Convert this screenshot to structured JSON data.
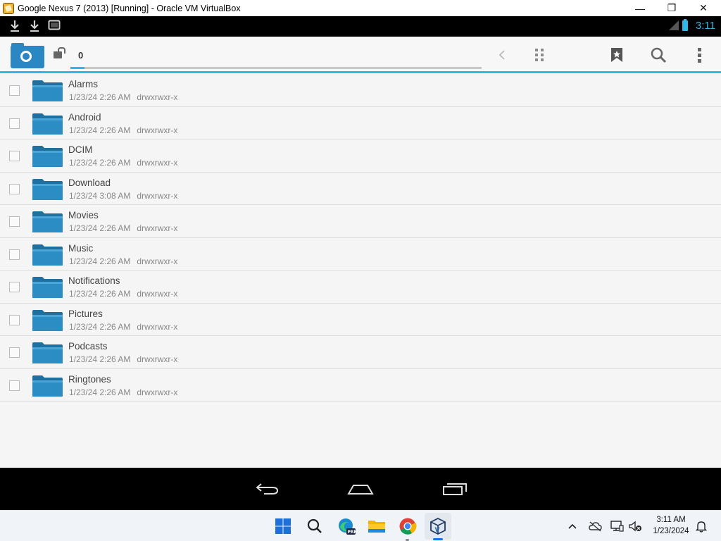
{
  "window": {
    "title": "Google Nexus 7 (2013) [Running] - Oracle VM VirtualBox",
    "minimize_glyph": "—",
    "maximize_glyph": "❐",
    "close_glyph": "✕"
  },
  "status_bar": {
    "notifications": [
      "download-icon",
      "download-icon",
      "screen-icon"
    ],
    "time": "3:11"
  },
  "action_bar": {
    "path": "0",
    "accent_color": "#33b5e5",
    "actions": [
      "back-icon",
      "grid-view-icon",
      "bookmark-icon",
      "search-icon",
      "overflow-menu-icon"
    ]
  },
  "files": [
    {
      "name": "Alarms",
      "date": "1/23/24 2:26 AM",
      "perms": "drwxrwxr-x"
    },
    {
      "name": "Android",
      "date": "1/23/24 2:26 AM",
      "perms": "drwxrwxr-x"
    },
    {
      "name": "DCIM",
      "date": "1/23/24 2:26 AM",
      "perms": "drwxrwxr-x"
    },
    {
      "name": "Download",
      "date": "1/23/24 3:08 AM",
      "perms": "drwxrwxr-x"
    },
    {
      "name": "Movies",
      "date": "1/23/24 2:26 AM",
      "perms": "drwxrwxr-x"
    },
    {
      "name": "Music",
      "date": "1/23/24 2:26 AM",
      "perms": "drwxrwxr-x"
    },
    {
      "name": "Notifications",
      "date": "1/23/24 2:26 AM",
      "perms": "drwxrwxr-x"
    },
    {
      "name": "Pictures",
      "date": "1/23/24 2:26 AM",
      "perms": "drwxrwxr-x"
    },
    {
      "name": "Podcasts",
      "date": "1/23/24 2:26 AM",
      "perms": "drwxrwxr-x"
    },
    {
      "name": "Ringtones",
      "date": "1/23/24 2:26 AM",
      "perms": "drwxrwxr-x"
    }
  ],
  "taskbar": {
    "apps": [
      "start-icon",
      "search-icon",
      "edge-icon",
      "file-explorer-icon",
      "chrome-icon",
      "virtualbox-icon"
    ],
    "clock_time": "3:11 AM",
    "clock_date": "1/23/2024"
  }
}
